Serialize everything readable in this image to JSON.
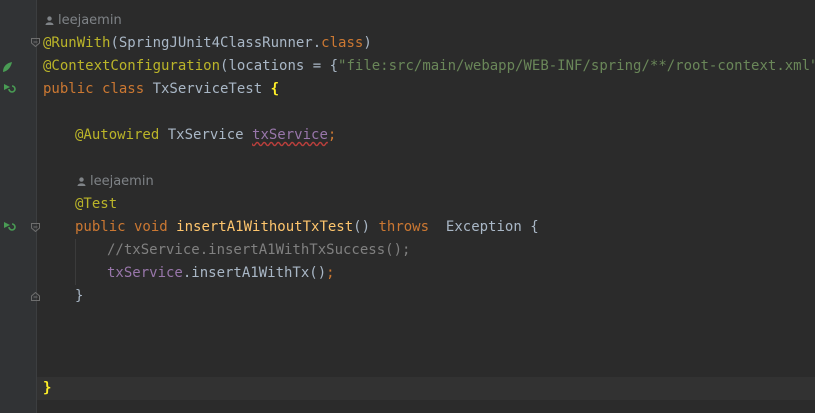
{
  "author_hint": "leejaemin",
  "lines": {
    "run_with_ann": "@RunWith",
    "run_with_args_a": "(SpringJUnit4ClassRunner.",
    "run_with_kw_class": "class",
    "run_with_args_b": ")",
    "ctx_ann": "@ContextConfiguration",
    "ctx_args_a": "(locations = {",
    "ctx_string": "\"file:src/main/webapp/WEB-INF/spring/**/root-context.xml\"",
    "ctx_args_b": "})",
    "class_kw": "public class ",
    "class_name": "TxServiceTest ",
    "class_brace": "{",
    "autowired_ann": "@Autowired",
    "autowired_type": " TxService ",
    "autowired_field": "txService",
    "semicolon": ";",
    "test_ann": "@Test",
    "method_kw": "public void ",
    "method_name": "insertA1WithoutTxTest",
    "method_parens": "() ",
    "throws_kw": "throws",
    "exception_part": "  Exception {",
    "comment": "//txService.insertA1WithTxSuccess();",
    "call_field": "txService",
    "call_rest": ".insertA1WithTx()",
    "close_method": "}",
    "close_class": "}"
  },
  "colors": {
    "background": "#2b2b2b",
    "gutter": "#313335",
    "annotation": "#bbb529",
    "keyword": "#cc7832",
    "string": "#6a8759",
    "field": "#9876aa",
    "method": "#ffc66d",
    "comment": "#808080",
    "text": "#a9b7c6",
    "brace_highlight": "#ffef28",
    "run_icon": "#499c54"
  },
  "icons": {
    "run_class": "run-test-icon",
    "run_method": "run-test-icon",
    "spring_bean": "spring-bean-icon",
    "fold": "fold-marker-icon",
    "author": "person-icon"
  }
}
